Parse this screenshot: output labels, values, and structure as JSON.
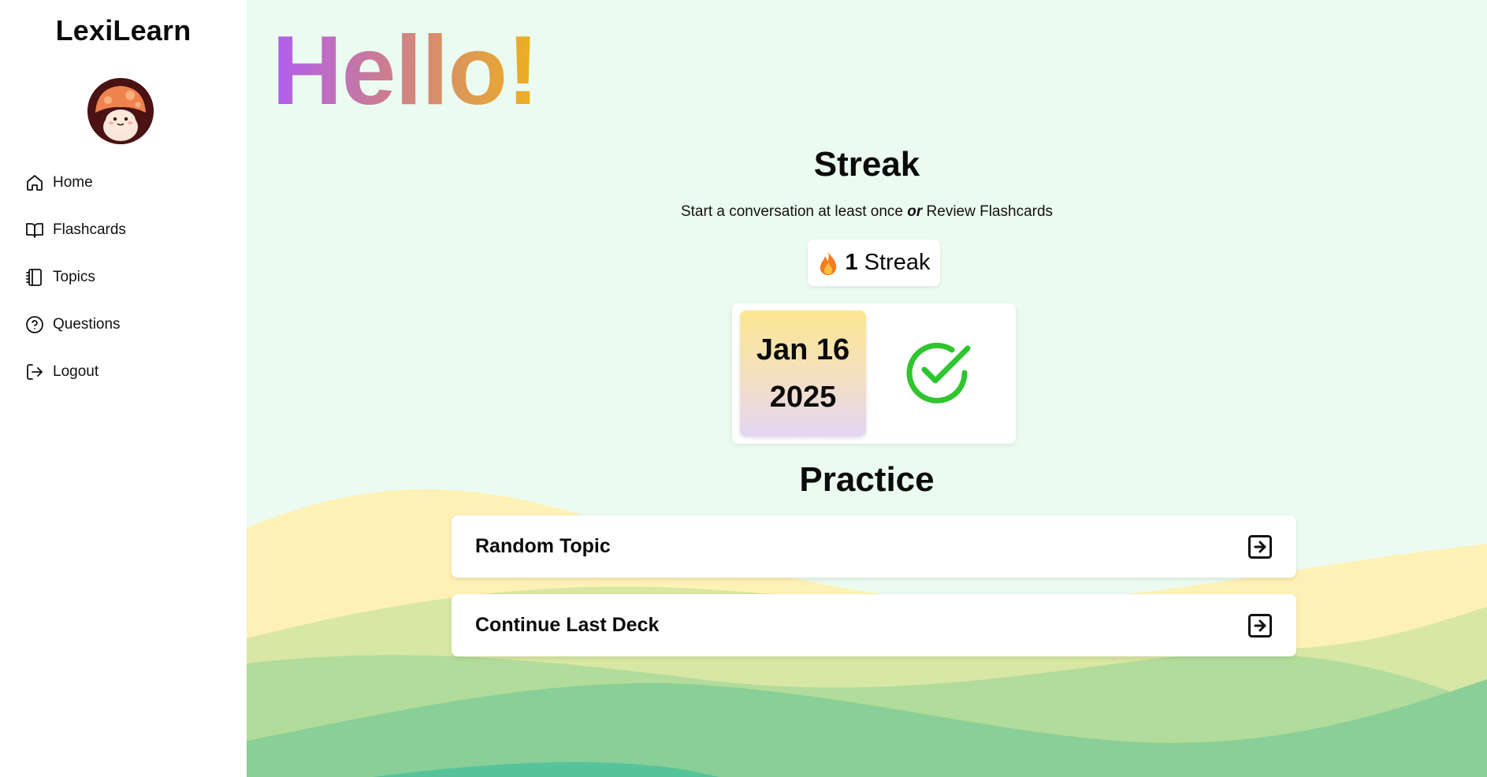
{
  "app": {
    "name": "LexiLearn"
  },
  "sidebar": {
    "items": [
      {
        "label": "Home",
        "icon": "home-icon"
      },
      {
        "label": "Flashcards",
        "icon": "book-icon"
      },
      {
        "label": "Topics",
        "icon": "notebook-icon"
      },
      {
        "label": "Questions",
        "icon": "help-circle-icon"
      },
      {
        "label": "Logout",
        "icon": "logout-icon"
      }
    ]
  },
  "main": {
    "greeting": "Hello!",
    "streak": {
      "title": "Streak",
      "subtitle_start": "Start a conversation at least once",
      "subtitle_or": "or",
      "subtitle_end": "Review Flashcards",
      "count": "1",
      "count_label": "Streak",
      "date_line1": "Jan 16",
      "date_line2": "2025",
      "completed": true
    },
    "practice": {
      "title": "Practice",
      "items": [
        {
          "label": "Random Topic",
          "icon": "arrow-right-square-icon"
        },
        {
          "label": "Continue Last Deck",
          "icon": "arrow-right-square-icon"
        }
      ]
    }
  },
  "colors": {
    "background": "#ebfbf1",
    "check": "#2ec52e",
    "greeting_gradient": [
      "#b05df2",
      "#cd7f8b",
      "#edb21d"
    ],
    "waves": [
      "#fef1b5",
      "#d8e7a4",
      "#b2dc9b",
      "#89cf97",
      "#56c39b"
    ]
  }
}
